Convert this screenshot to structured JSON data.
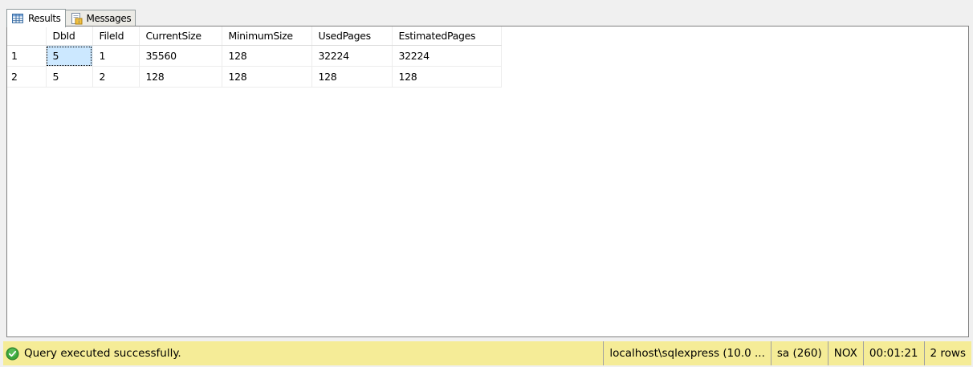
{
  "tabs": [
    {
      "label": "Results",
      "icon": "grid-icon",
      "active": true
    },
    {
      "label": "Messages",
      "icon": "messages-icon",
      "active": false
    }
  ],
  "grid": {
    "columns": [
      "DbId",
      "FileId",
      "CurrentSize",
      "MinimumSize",
      "UsedPages",
      "EstimatedPages"
    ],
    "rows": [
      {
        "num": "1",
        "cells": [
          "5",
          "1",
          "35560",
          "128",
          "32224",
          "32224"
        ]
      },
      {
        "num": "2",
        "cells": [
          "5",
          "2",
          "128",
          "128",
          "128",
          "128"
        ]
      }
    ]
  },
  "status": {
    "message": "Query executed successfully.",
    "icon": "check-circle-icon",
    "server": "localhost\\sqlexpress (10.0 ...",
    "user": "sa (260)",
    "database": "NOX",
    "elapsed": "00:01:21",
    "rowcount": "2 rows",
    "colors": {
      "statusbar_bg": "#f5ec97",
      "success_green": "#3aa63a",
      "selected_cell": "#cce8ff"
    }
  }
}
